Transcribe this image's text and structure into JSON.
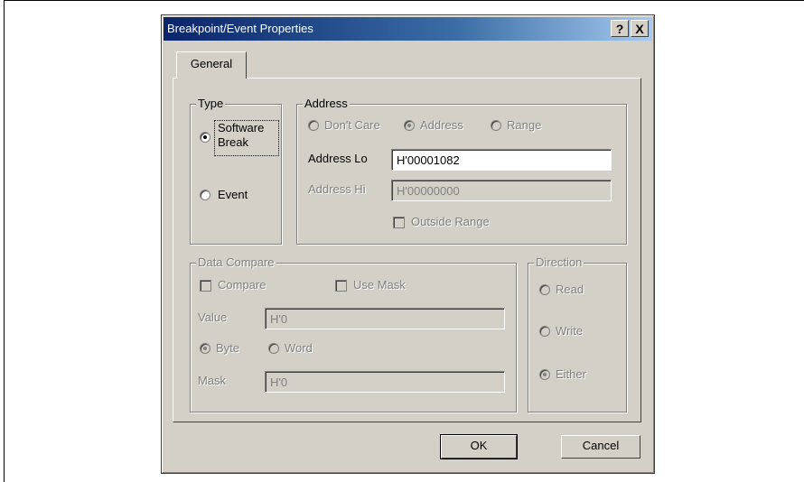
{
  "dialog": {
    "title": "Breakpoint/Event Properties",
    "help_glyph": "?",
    "close_glyph": "X"
  },
  "tabs": [
    {
      "label": "General"
    }
  ],
  "type_group": {
    "label": "Type",
    "software_break_line1": "Software",
    "software_break_line2": "Break",
    "software_break_selected": true,
    "event_label": "Event",
    "event_selected": false
  },
  "address_group": {
    "label": "Address",
    "dont_care": "Don't Care",
    "address": "Address",
    "range": "Range",
    "selected": "Address",
    "address_lo_label": "Address Lo",
    "address_lo_value": "H'00001082",
    "address_hi_label": "Address Hi",
    "address_hi_value": "H'00000000",
    "outside_range": "Outside Range"
  },
  "data_compare_group": {
    "label": "Data Compare",
    "compare": "Compare",
    "use_mask": "Use Mask",
    "value_label": "Value",
    "value": "H'0",
    "byte": "Byte",
    "word": "Word",
    "selected": "Byte",
    "mask_label": "Mask",
    "mask_value": "H'0"
  },
  "direction_group": {
    "label": "Direction",
    "read": "Read",
    "write": "Write",
    "either": "Either",
    "selected": "Either"
  },
  "buttons": {
    "ok": "OK",
    "cancel": "Cancel"
  }
}
